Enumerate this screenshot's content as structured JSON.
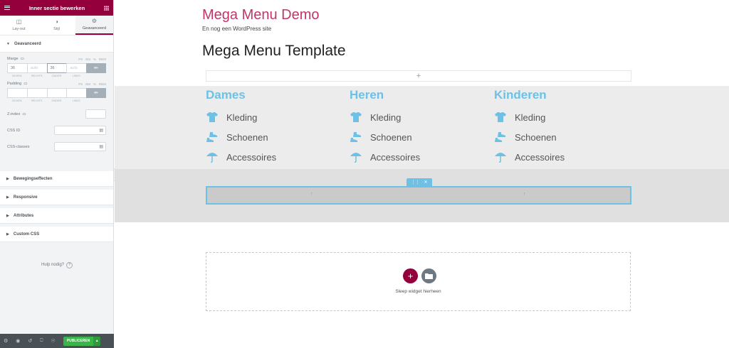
{
  "panel": {
    "title": "Inner sectie bewerken",
    "tabs": [
      {
        "label": "Lay-out",
        "icon": "layout-icon"
      },
      {
        "label": "Stijl",
        "icon": "style-icon"
      },
      {
        "label": "Geavanceerd",
        "icon": "gear-icon"
      }
    ],
    "advanced": {
      "heading": "Geavanceerd",
      "margin": {
        "label": "Marge",
        "units": [
          "PX",
          "EM",
          "%",
          "REM"
        ],
        "top": "36",
        "right_placeholder": "auto",
        "bottom": "36",
        "left_placeholder": "auto",
        "side_labels": [
          "BOVEN",
          "RECHTS",
          "ONDER",
          "LINKS"
        ]
      },
      "padding": {
        "label": "Padding",
        "units": [
          "PX",
          "EM",
          "%",
          "REM"
        ],
        "side_labels": [
          "BOVEN",
          "RECHTS",
          "ONDER",
          "LINKS"
        ]
      },
      "zindex_label": "Z-index",
      "cssid_label": "CSS ID",
      "cssclasses_label": "CSS-classes"
    },
    "sections": [
      "Bewegingseffecten",
      "Responsive",
      "Attributes",
      "Custom CSS"
    ],
    "help_text": "Hulp nodig?",
    "footer": {
      "publish_label": "PUBLICEREN"
    }
  },
  "site": {
    "title": "Mega Menu Demo",
    "tagline": "En nog een WordPress site"
  },
  "page_title": "Mega Menu Template",
  "mega_menu": {
    "accent_color": "#6ec1e4",
    "columns": [
      {
        "heading": "Dames",
        "items": [
          {
            "label": "Kleding",
            "icon": "tshirt-icon"
          },
          {
            "label": "Schoenen",
            "icon": "shoes-icon"
          },
          {
            "label": "Accessoires",
            "icon": "umbrella-icon"
          }
        ]
      },
      {
        "heading": "Heren",
        "items": [
          {
            "label": "Kleding",
            "icon": "tshirt-icon"
          },
          {
            "label": "Schoenen",
            "icon": "shoes-icon"
          },
          {
            "label": "Accessoires",
            "icon": "umbrella-icon"
          }
        ]
      },
      {
        "heading": "Kinderen",
        "items": [
          {
            "label": "Kleding",
            "icon": "tshirt-icon"
          },
          {
            "label": "Schoenen",
            "icon": "shoes-icon"
          },
          {
            "label": "Accessoires",
            "icon": "umbrella-icon"
          }
        ]
      }
    ]
  },
  "drop_zone": {
    "text": "Sleep widget hierheen"
  },
  "colors": {
    "brand": "#93003c",
    "publish": "#39b54a",
    "title": "#c13569"
  }
}
